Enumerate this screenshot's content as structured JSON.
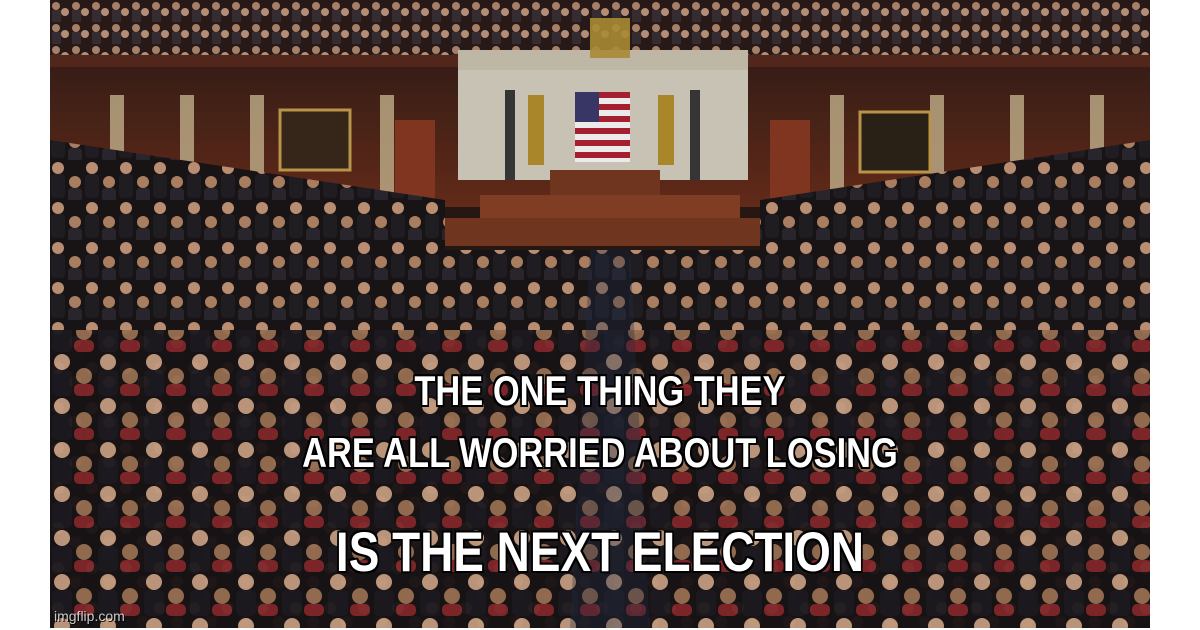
{
  "meme": {
    "caption_line_1": "THE ONE THING THEY",
    "caption_line_2": "ARE ALL WORRIED ABOUT LOSING",
    "caption_line_3": "IS THE NEXT ELECTION",
    "watermark": "imgflip.com"
  },
  "colors": {
    "background": "#ffffff",
    "chamber_wall": "#6b2e1c",
    "podium_marble": "#d9d3c4",
    "caption_text": "#ffffff",
    "caption_outline": "#000000"
  }
}
